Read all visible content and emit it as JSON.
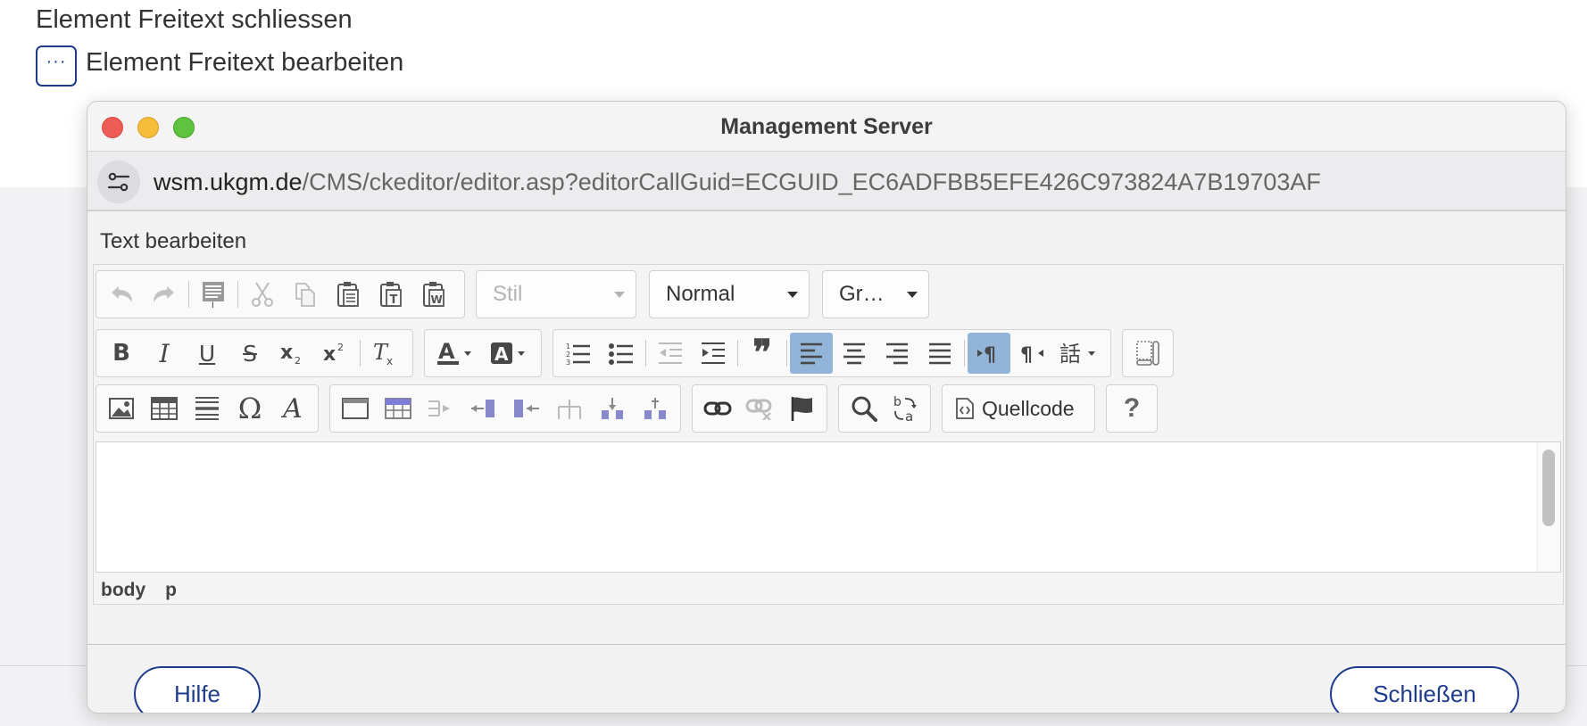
{
  "page": {
    "close_link": "Element Freitext schliessen",
    "edit_link": "Element Freitext bearbeiten",
    "dots_label": "···"
  },
  "window": {
    "title": "Management Server",
    "url_host": "wsm.ukgm.de",
    "url_path": "/CMS/ckeditor/editor.asp?editorCallGuid=ECGUID_EC6ADFBB5EFE426C973824A7B19703AF"
  },
  "dialog": {
    "heading": "Text bearbeiten",
    "style_combo": "Stil",
    "format_combo": "Normal",
    "size_combo": "Gr…",
    "source_label": "Quellcode",
    "help_glyph": "?",
    "path": [
      "body",
      "p"
    ],
    "help_button": "Hilfe",
    "close_button": "Schließen"
  },
  "colors": {
    "accent": "#1e3c8c",
    "active_toggle": "#92b4d8"
  }
}
